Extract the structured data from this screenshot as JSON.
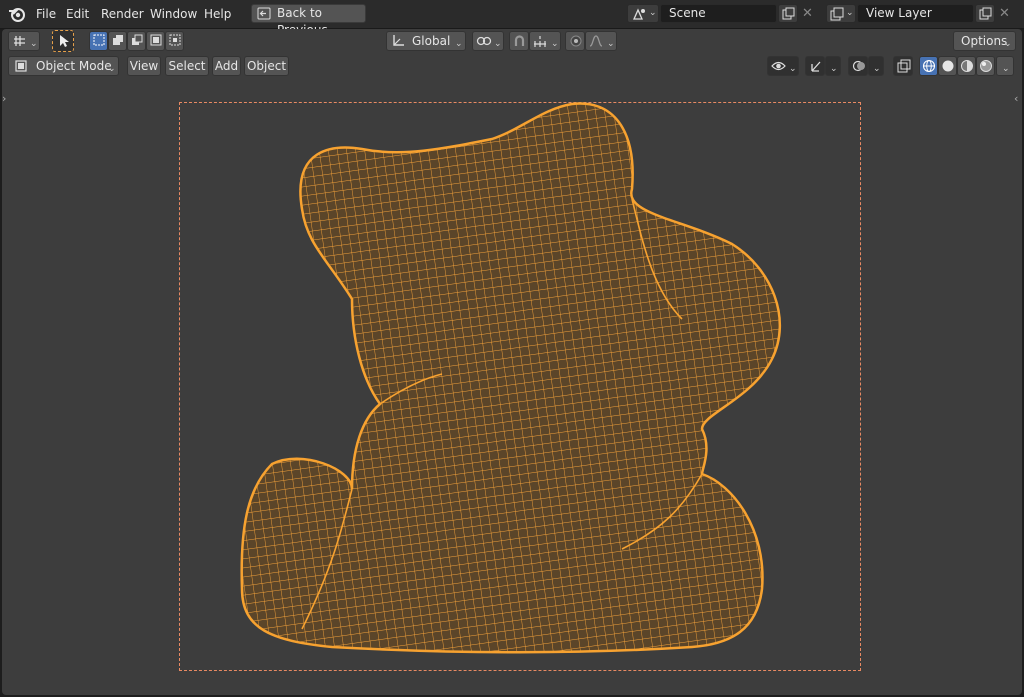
{
  "menubar": {
    "items": [
      "File",
      "Edit",
      "Render",
      "Window",
      "Help"
    ],
    "back_button": "Back to Previous",
    "scene": "Scene",
    "view_layer": "View Layer"
  },
  "toolbar": {
    "transform_orientation": "Global",
    "options": "Options"
  },
  "viewport_header": {
    "mode": "Object Mode",
    "menus": [
      "View",
      "Select",
      "Add",
      "Object"
    ]
  },
  "colors": {
    "accent_blue": "#4772b3",
    "wireframe": "#f5a33a",
    "camera_frame": "#e98a63"
  },
  "icons": [
    "blender-logo-icon",
    "back-icon",
    "scene-icon",
    "view-layer-icon",
    "copy-icon",
    "close-icon",
    "editor-type-icon",
    "select-tool-icon",
    "select-box-icon",
    "transform-orientation-icon",
    "pivot-icon",
    "snap-icon",
    "proportional-edit-icon",
    "falloff-icon",
    "object-mode-icon",
    "visibility-icon",
    "gizmo-icon",
    "overlay-icon",
    "xray-icon",
    "wireframe-shading-icon",
    "solid-shading-icon",
    "material-shading-icon",
    "rendered-shading-icon"
  ]
}
